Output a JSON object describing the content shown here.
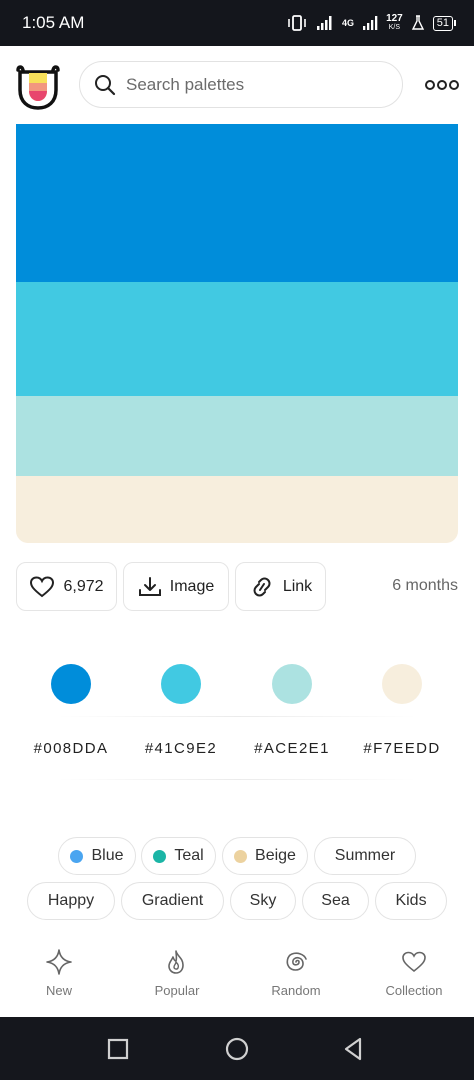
{
  "status_bar": {
    "time": "1:05 AM",
    "network": "4G",
    "speed_value": "127",
    "speed_unit": "K/S",
    "battery": "51"
  },
  "header": {
    "logo_icon": "tongue-face-logo",
    "search": {
      "placeholder": "Search palettes",
      "value": ""
    },
    "menu_icon": "more-dots-icon"
  },
  "palette": {
    "colors": [
      "#008DDA",
      "#41C9E2",
      "#ACE2E1",
      "#F7EEDD"
    ],
    "band_shares": [
      0.377,
      0.272,
      0.19,
      0.161
    ]
  },
  "actions": {
    "like_count": "6,972",
    "image_label": "Image",
    "link_label": "Link",
    "age": "6 months"
  },
  "color_codes": [
    "#008DDA",
    "#41C9E2",
    "#ACE2E1",
    "#F7EEDD"
  ],
  "tags": [
    {
      "label": "Blue",
      "dot": "#4aa5f0"
    },
    {
      "label": "Teal",
      "dot": "#1bb5a6"
    },
    {
      "label": "Beige",
      "dot": "#ecd29f"
    },
    {
      "label": "Summer"
    },
    {
      "label": "Happy"
    },
    {
      "label": "Gradient"
    },
    {
      "label": "Sky"
    },
    {
      "label": "Sea"
    },
    {
      "label": "Kids"
    }
  ],
  "bottom_nav": [
    {
      "label": "New",
      "icon": "sparkle-icon"
    },
    {
      "label": "Popular",
      "icon": "flame-icon"
    },
    {
      "label": "Random",
      "icon": "spiral-icon"
    },
    {
      "label": "Collection",
      "icon": "heart-icon"
    }
  ],
  "system_nav": [
    "recents-square-icon",
    "home-circle-icon",
    "back-triangle-icon"
  ]
}
